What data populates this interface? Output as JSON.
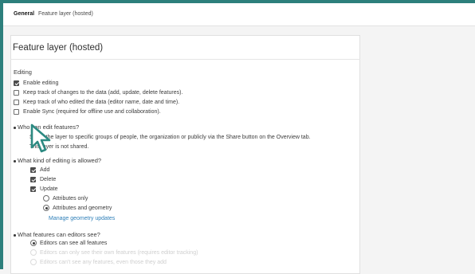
{
  "tabs": {
    "general": "General",
    "feature_layer": "Feature layer (hosted)"
  },
  "card": {
    "title": "Feature layer (hosted)"
  },
  "editing": {
    "heading": "Editing",
    "options": [
      {
        "label": "Enable editing",
        "checked": true
      },
      {
        "label": "Keep track of changes to the data (add, update, delete features).",
        "checked": false
      },
      {
        "label": "Keep track of who edited the data (editor name, date and time).",
        "checked": false
      },
      {
        "label": "Enable Sync (required for offline use and collaboration).",
        "checked": false
      }
    ]
  },
  "who_can_edit": {
    "question": "Who can edit features?",
    "description": "Share the layer to specific groups of people, the organization or publicly via the Share button on the Overview tab.",
    "status": "This layer is not shared."
  },
  "editing_allowed": {
    "question": "What kind of editing is allowed?",
    "add": {
      "label": "Add",
      "checked": true
    },
    "delete": {
      "label": "Delete",
      "checked": true
    },
    "update": {
      "label": "Update",
      "checked": true
    },
    "attributes_only": {
      "label": "Attributes only",
      "selected": false
    },
    "attributes_geometry": {
      "label": "Attributes and geometry",
      "selected": true
    },
    "manage_link": "Manage geometry updates"
  },
  "editors_see": {
    "question": "What features can editors see?",
    "all": {
      "label": "Editors can see all features",
      "selected": true
    },
    "own": {
      "label": "Editors can only see their own features (requires editor tracking)",
      "selected": false,
      "disabled": true
    },
    "none": {
      "label": "Editors can't see any features, even those they add",
      "selected": false,
      "disabled": true
    }
  },
  "colors": {
    "accent": "#2d7f7c",
    "link": "#2e7fb8",
    "disabled_text": "#cfcfcf"
  }
}
